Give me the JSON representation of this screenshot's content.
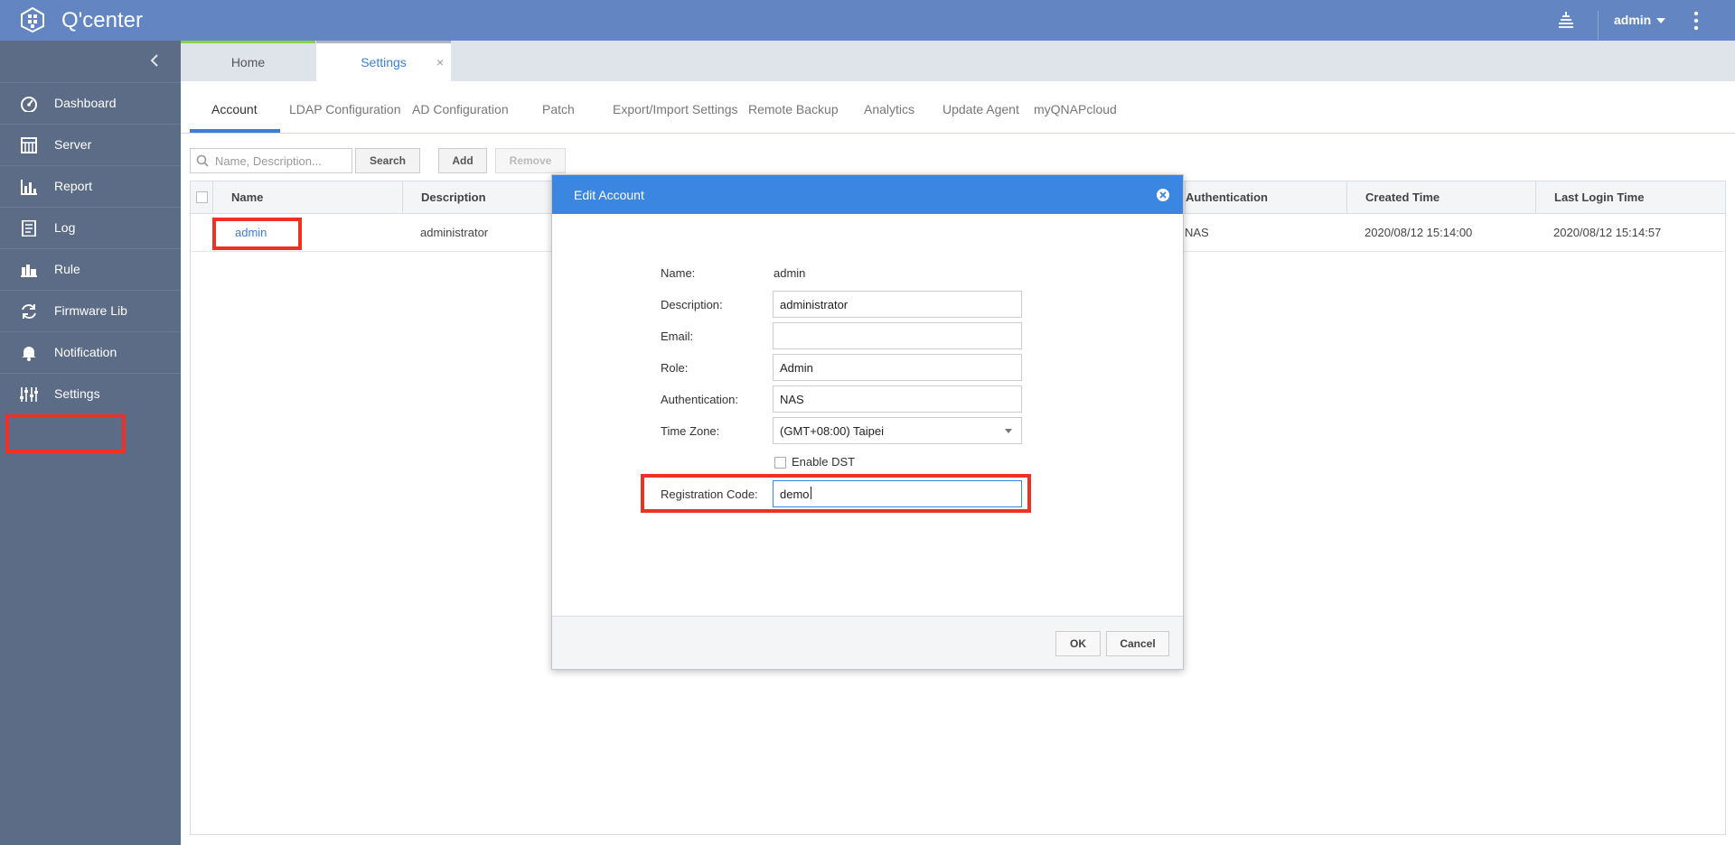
{
  "app": {
    "title": "Q'center",
    "user": "admin"
  },
  "sidebar": {
    "items": [
      {
        "label": "Dashboard",
        "icon": "dashboard-icon"
      },
      {
        "label": "Server",
        "icon": "server-icon"
      },
      {
        "label": "Report",
        "icon": "report-icon"
      },
      {
        "label": "Log",
        "icon": "log-icon"
      },
      {
        "label": "Rule",
        "icon": "rule-icon"
      },
      {
        "label": "Firmware Lib",
        "icon": "refresh-icon"
      },
      {
        "label": "Notification",
        "icon": "bell-icon"
      },
      {
        "label": "Settings",
        "icon": "sliders-icon"
      }
    ]
  },
  "window_tabs": [
    {
      "label": "Home"
    },
    {
      "label": "Settings",
      "close": "×"
    }
  ],
  "subtabs": [
    {
      "label": "Account"
    },
    {
      "label": "LDAP Configuration"
    },
    {
      "label": "AD Configuration"
    },
    {
      "label": "Patch"
    },
    {
      "label": "Export/Import Settings"
    },
    {
      "label": "Remote Backup"
    },
    {
      "label": "Analytics"
    },
    {
      "label": "Update Agent"
    },
    {
      "label": "myQNAPcloud"
    }
  ],
  "toolbar": {
    "search_placeholder": "Name, Description...",
    "search_label": "Search",
    "add_label": "Add",
    "remove_label": "Remove"
  },
  "table": {
    "columns": [
      {
        "label": "Name"
      },
      {
        "label": "Description"
      },
      {
        "label": "Authentication"
      },
      {
        "label": "Created Time"
      },
      {
        "label": "Last Login Time"
      }
    ],
    "rows": [
      {
        "name": "admin",
        "description": "administrator",
        "authentication": "NAS",
        "created": "2020/08/12 15:14:00",
        "last_login": "2020/08/12 15:14:57"
      }
    ]
  },
  "modal": {
    "title": "Edit Account",
    "fields": {
      "name_label": "Name:",
      "name_value": "admin",
      "description_label": "Description:",
      "description_value": "administrator",
      "email_label": "Email:",
      "email_value": "",
      "role_label": "Role:",
      "role_value": "Admin",
      "auth_label": "Authentication:",
      "auth_value": "NAS",
      "timezone_label": "Time Zone:",
      "timezone_value": "(GMT+08:00) Taipei",
      "dst_label": "Enable DST",
      "regcode_label": "Registration Code:",
      "regcode_value": "demo"
    },
    "ok_label": "OK",
    "cancel_label": "Cancel"
  },
  "colors": {
    "topbar": "#6385c1",
    "sidebar": "#5c6b86",
    "accent": "#3b7fd3",
    "highlight": "#ee3124"
  }
}
